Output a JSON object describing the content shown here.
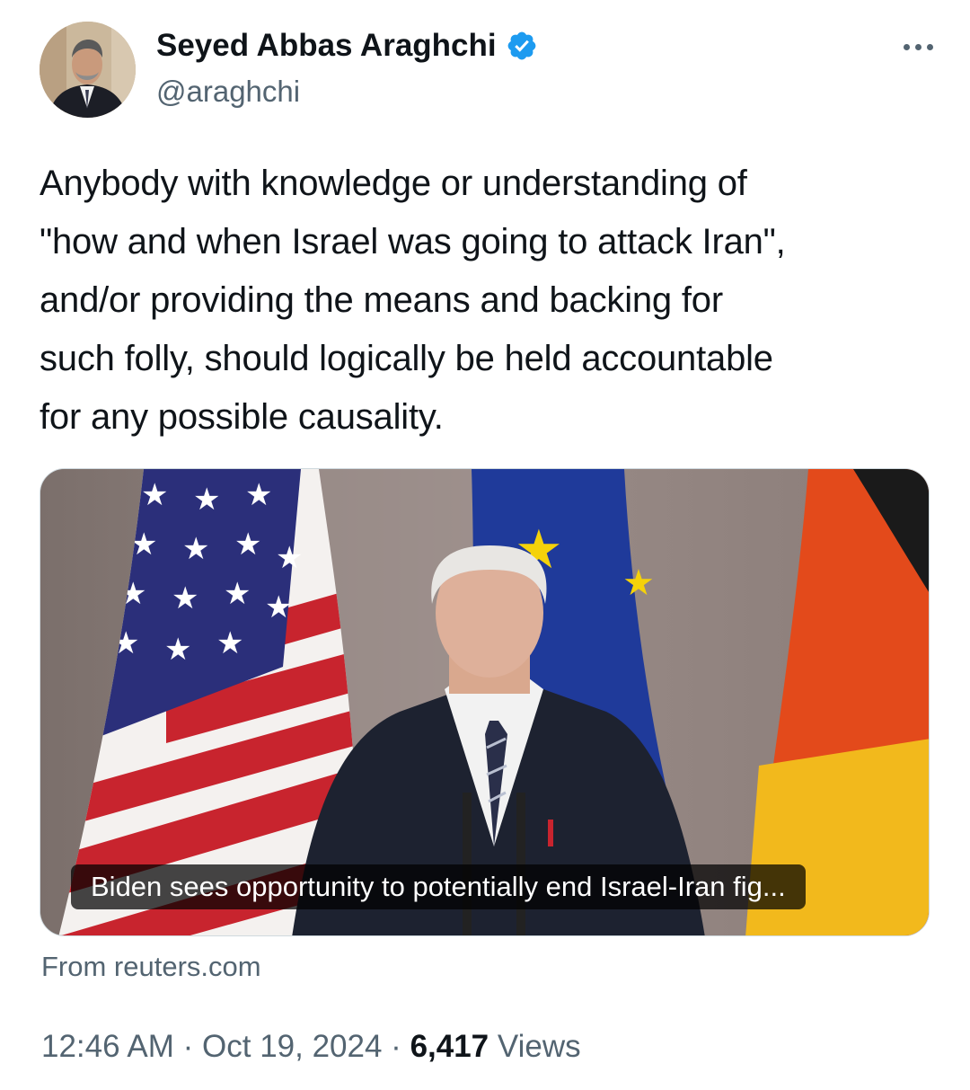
{
  "author": {
    "display_name": "Seyed Abbas Araghchi",
    "handle": "@araghchi",
    "verified_icon": "verified-badge-icon",
    "verified_color": "#1d9bf0"
  },
  "tweet": {
    "text": "Anybody with knowledge or understanding of\n\"how and when Israel was going to attack Iran\",\nand/or providing the means and backing for\nsuch folly, should logically be held accountable\nfor any possible causality."
  },
  "link_card": {
    "caption": "Biden sees opportunity to potentially end Israel-Iran fig...",
    "source": "From reuters.com"
  },
  "meta": {
    "time": "12:46 AM",
    "separator": "·",
    "date": "Oct 19, 2024",
    "views_count": "6,417",
    "views_label": "Views"
  },
  "colors": {
    "text_primary": "#0f1419",
    "text_secondary": "#536471",
    "border": "#cfd9de"
  }
}
